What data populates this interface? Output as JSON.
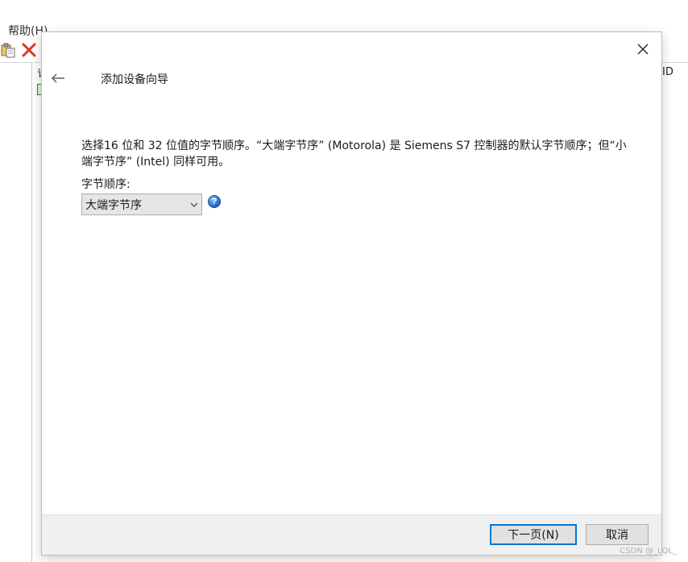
{
  "background_window": {
    "menu_help": "帮助(H)",
    "column_header_fragment": "ID",
    "tree_fragment": "讠"
  },
  "dialog": {
    "title": "添加设备向导",
    "description": "选择16 位和 32 位值的字节顺序。“大端字节序” (Motorola) 是 Siemens S7 控制器的默认字节顺序；但“小端字节序” (Intel) 同样可用。",
    "byte_order": {
      "label": "字节顺序:",
      "selected": "大端字节序"
    },
    "help_glyph": "?",
    "buttons": {
      "next": "下一页(N)",
      "cancel": "取消"
    }
  },
  "watermark": "CSDN @_LQL_",
  "colors": {
    "accent": "#0078d7",
    "footer_bg": "#f0f0f0",
    "select_bg": "#e5e5e5"
  },
  "icons": {
    "close": "close-icon",
    "back": "arrow-left-icon",
    "dropdown": "chevron-down-icon",
    "help": "help-icon",
    "toolbar_paste": "paste-icon",
    "toolbar_delete": "delete-icon"
  }
}
